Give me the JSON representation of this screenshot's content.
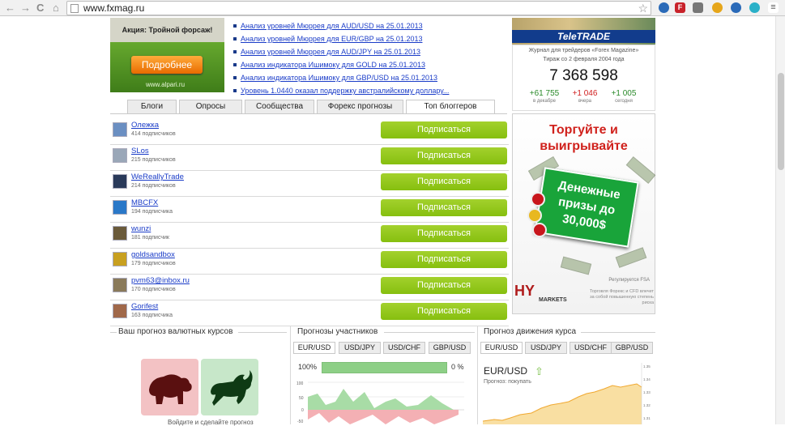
{
  "browser": {
    "url": "www.fxmag.ru",
    "back": "←",
    "forward": "→",
    "reload": "C",
    "home": "⌂",
    "star": "☆"
  },
  "promo": {
    "title": "Акция: Тройной форсаж!",
    "button": "Подробнее",
    "domain": "www.alpari.ru"
  },
  "news": [
    "Анализ уровней Мюррея для AUD/USD на 25.01.2013",
    "Анализ уровней Мюррея для EUR/GBP на 25.01.2013",
    "Анализ уровней Мюррея для AUD/JPY на 25.01.2013",
    "Анализ индикатора Ишимоку для GOLD на 25.01.2013",
    "Анализ индикатора Ишимоку для GBP/USD на 25.01.2013",
    "Уровень 1.0440 оказал поддержку австралийскому доллару..."
  ],
  "tabs": [
    "Блоги",
    "Опросы",
    "Сообщества",
    "Форекс прогнозы",
    "Топ блоггеров"
  ],
  "subscribe_label": "Подписаться",
  "bloggers": [
    {
      "name": "Олежка",
      "subs": "414 подписчиков"
    },
    {
      "name": "SLos",
      "subs": "215 подписчиков"
    },
    {
      "name": "WeReallyTrade",
      "subs": "214 подписчиков"
    },
    {
      "name": "MBCFX",
      "subs": "194 подписчика"
    },
    {
      "name": "wunzi",
      "subs": "181 подписчик"
    },
    {
      "name": "goldsandbox",
      "subs": "179 подписчиков"
    },
    {
      "name": "pvm63@inbox.ru",
      "subs": "170 подписчиков"
    },
    {
      "name": "Gorifest",
      "subs": "163 подписчика"
    }
  ],
  "teletrade": {
    "logo": "TeleTRADE"
  },
  "magazine": {
    "line1": "Журнал для трейдеров «Forex Magazine»",
    "line2": "Тираж со 2 февраля 2004 года",
    "total": "7 368 598",
    "stats": [
      {
        "value": "+61 755",
        "caption": "в декабре",
        "color": "green"
      },
      {
        "value": "+1 046",
        "caption": "вчера",
        "color": "red"
      },
      {
        "value": "+1 005",
        "caption": "сегодня",
        "color": "green"
      }
    ]
  },
  "ad": {
    "headline": "Торгуйте и выигрывайте",
    "prize": "Денежные призы до 30,000$",
    "regulated": "Регулируется FSA",
    "brand": "HY",
    "brand_sub": "MARKETS",
    "disclaimer": "Торговля Форекс и CFD влечет за собой повышенную степень риска"
  },
  "sections": {
    "forecast": "Ваш прогноз валютных курсов",
    "participants": "Прогнозы участников",
    "movement": "Прогноз движения курса"
  },
  "currency_tabs": [
    "EUR/USD",
    "USD/JPY",
    "USD/CHF",
    "GBP/USD"
  ],
  "forecast_caption": "Войдите и сделайте прогноз",
  "participants": {
    "pct_left": "100%",
    "pct_right": "0 %",
    "bar_fraction": 1.0,
    "y_ticks": [
      "100",
      "50",
      "0",
      "-50"
    ]
  },
  "movement": {
    "title": "EUR/USD",
    "arrow": "⇧",
    "advice": "Прогноз: покупать",
    "y_ticks": [
      "1.35",
      "1.34",
      "1.33",
      "1.32",
      "1.31"
    ]
  }
}
